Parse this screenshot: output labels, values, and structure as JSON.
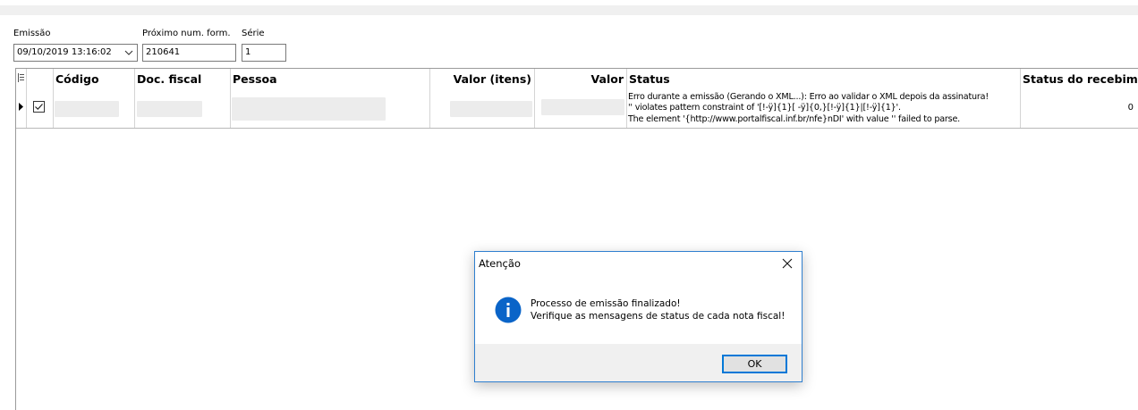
{
  "form": {
    "emissao_label": "Emissão",
    "emissao_value": "09/10/2019 13:16:02",
    "proximo_label": "Próximo num. form.",
    "proximo_value": "210641",
    "serie_label": "Série",
    "serie_value": "1"
  },
  "grid": {
    "columns": [
      "Código",
      "Doc. fiscal",
      "Pessoa",
      "Valor (itens)",
      "Valor",
      "Status",
      "Status do recebime"
    ],
    "rows": [
      {
        "checked": true,
        "status_lines": [
          "Erro durante a emissão (Gerando o XML...): Erro ao validar o XML depois da assinatura!",
          "'' violates pattern constraint of '[!-ÿ]{1}[ -ÿ]{0,}[!-ÿ]{1}|[!-ÿ]{1}'.",
          "The element '{http://www.portalfiscal.inf.br/nfe}nDI' with value '' failed to parse."
        ],
        "status_recebimento": "0"
      }
    ]
  },
  "dialog": {
    "title": "Atenção",
    "message_line1": "Processo de emissão finalizado!",
    "message_line2": "Verifique as mensagens de status de cada nota fiscal!",
    "ok_label": "OK"
  },
  "colors": {
    "accent": "#0078d7",
    "info_icon": "#0a64c8"
  }
}
